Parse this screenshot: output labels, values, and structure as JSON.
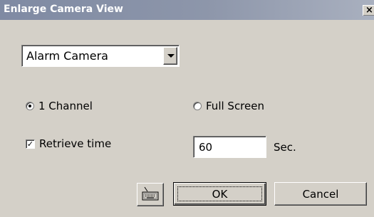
{
  "window": {
    "title": "Enlarge Camera View",
    "close_label": "×"
  },
  "camera_select": {
    "selected_value": "Alarm Camera"
  },
  "view_mode": {
    "option_1": "1 Channel",
    "option_2": "Full Screen",
    "selected": "1 Channel"
  },
  "retrieve_time": {
    "label": "Retrieve time",
    "checked": true,
    "value": "60",
    "unit": "Sec."
  },
  "buttons": {
    "ok_label": "OK",
    "cancel_label": "Cancel",
    "keyboard_icon": "keyboard-icon"
  },
  "colors": {
    "dialog_bg": "#d4d0c8",
    "title_bar": "#8d96aa",
    "title_text": "#ffffff"
  }
}
